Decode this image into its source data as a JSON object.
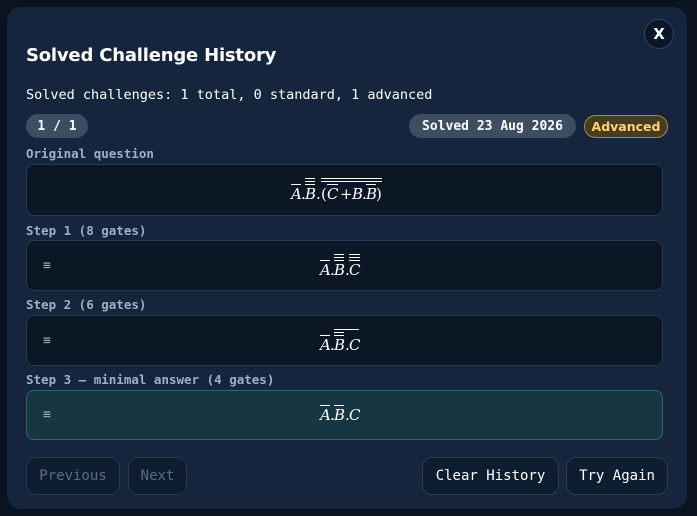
{
  "modal": {
    "title": "Solved Challenge History",
    "close_label": "X",
    "summary": "Solved challenges: 1 total, 0 standard, 1 advanced",
    "counter": "1 / 1",
    "solved_date": "Solved 23 Aug 2026",
    "level": "Advanced"
  },
  "question": {
    "label": "Original question",
    "expression_label": "A.B.(C+B.B)"
  },
  "steps": [
    {
      "label": "Step 1 (8 gates)",
      "drag_icon": "≡",
      "expression_label": "A.B.C"
    },
    {
      "label": "Step 2 (6 gates)",
      "drag_icon": "≡",
      "expression_label": "A.B.C"
    },
    {
      "label": "Step 3 — minimal answer (4 gates)",
      "drag_icon": "≡",
      "expression_label": "A.B.C"
    }
  ],
  "buttons": {
    "previous": "Previous",
    "next": "Next",
    "clear": "Clear History",
    "try_again": "Try Again"
  },
  "colors": {
    "modal_bg": "#14253d",
    "final_step_bg": "#163741",
    "advanced_badge": "#ffd27a"
  },
  "icons": [
    "close-icon",
    "drag-handle-icon"
  ]
}
